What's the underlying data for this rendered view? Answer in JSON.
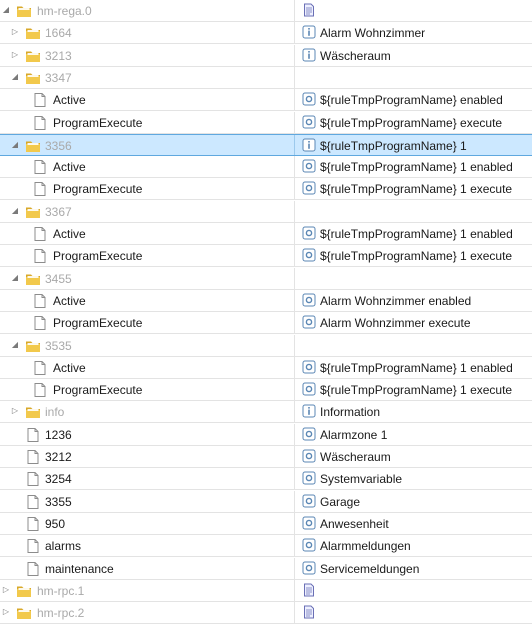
{
  "rows": [
    {
      "name": "hm-rega.0",
      "kind": "folder",
      "depth": 0,
      "expanded": true,
      "dim": true,
      "value": "",
      "value_icon": "document-icon"
    },
    {
      "name": "1664",
      "kind": "folder",
      "depth": 1,
      "expanded": false,
      "dim": true,
      "value": "Alarm Wohnzimmer",
      "value_icon": "info-icon"
    },
    {
      "name": "3213",
      "kind": "folder",
      "depth": 1,
      "expanded": false,
      "dim": true,
      "value": "Wäscheraum",
      "value_icon": "info-icon"
    },
    {
      "name": "3347",
      "kind": "folder",
      "depth": 1,
      "expanded": true,
      "dim": true,
      "value": "",
      "value_icon": ""
    },
    {
      "name": "Active",
      "kind": "file",
      "depth": 2,
      "dim": false,
      "value": "${ruleTmpProgramName} enabled",
      "value_icon": "state-icon"
    },
    {
      "name": "ProgramExecute",
      "kind": "file",
      "depth": 2,
      "dim": false,
      "value": "${ruleTmpProgramName} execute",
      "value_icon": "state-icon"
    },
    {
      "name": "3356",
      "kind": "folder",
      "depth": 1,
      "expanded": true,
      "dim": true,
      "selected": true,
      "value": "${ruleTmpProgramName} 1",
      "value_icon": "info-icon"
    },
    {
      "name": "Active",
      "kind": "file",
      "depth": 2,
      "dim": false,
      "value": "${ruleTmpProgramName} 1 enabled",
      "value_icon": "state-icon"
    },
    {
      "name": "ProgramExecute",
      "kind": "file",
      "depth": 2,
      "dim": false,
      "value": "${ruleTmpProgramName} 1 execute",
      "value_icon": "state-icon"
    },
    {
      "name": "3367",
      "kind": "folder",
      "depth": 1,
      "expanded": true,
      "dim": true,
      "value": "",
      "value_icon": ""
    },
    {
      "name": "Active",
      "kind": "file",
      "depth": 2,
      "dim": false,
      "value": "${ruleTmpProgramName} 1 enabled",
      "value_icon": "state-icon"
    },
    {
      "name": "ProgramExecute",
      "kind": "file",
      "depth": 2,
      "dim": false,
      "value": "${ruleTmpProgramName} 1 execute",
      "value_icon": "state-icon"
    },
    {
      "name": "3455",
      "kind": "folder",
      "depth": 1,
      "expanded": true,
      "dim": true,
      "value": "",
      "value_icon": ""
    },
    {
      "name": "Active",
      "kind": "file",
      "depth": 2,
      "dim": false,
      "value": "Alarm Wohnzimmer enabled",
      "value_icon": "state-icon"
    },
    {
      "name": "ProgramExecute",
      "kind": "file",
      "depth": 2,
      "dim": false,
      "value": "Alarm Wohnzimmer execute",
      "value_icon": "state-icon"
    },
    {
      "name": "3535",
      "kind": "folder",
      "depth": 1,
      "expanded": true,
      "dim": true,
      "value": "",
      "value_icon": ""
    },
    {
      "name": "Active",
      "kind": "file",
      "depth": 2,
      "dim": false,
      "value": "${ruleTmpProgramName} 1 enabled",
      "value_icon": "state-icon"
    },
    {
      "name": "ProgramExecute",
      "kind": "file",
      "depth": 2,
      "dim": false,
      "value": "${ruleTmpProgramName} 1 execute",
      "value_icon": "state-icon"
    },
    {
      "name": "info",
      "kind": "folder",
      "depth": 1,
      "expanded": false,
      "dim": true,
      "value": "Information",
      "value_icon": "info-icon"
    },
    {
      "name": "1236",
      "kind": "file",
      "depth": 1,
      "dim": false,
      "value": "Alarmzone 1",
      "value_icon": "state-icon"
    },
    {
      "name": "3212",
      "kind": "file",
      "depth": 1,
      "dim": false,
      "value": "Wäscheraum",
      "value_icon": "state-icon"
    },
    {
      "name": "3254",
      "kind": "file",
      "depth": 1,
      "dim": false,
      "value": "Systemvariable",
      "value_icon": "state-icon"
    },
    {
      "name": "3355",
      "kind": "file",
      "depth": 1,
      "dim": false,
      "value": "Garage",
      "value_icon": "state-icon"
    },
    {
      "name": "950",
      "kind": "file",
      "depth": 1,
      "dim": false,
      "value": "Anwesenheit",
      "value_icon": "state-icon"
    },
    {
      "name": "alarms",
      "kind": "file",
      "depth": 1,
      "dim": false,
      "value": "Alarmmeldungen",
      "value_icon": "state-icon"
    },
    {
      "name": "maintenance",
      "kind": "file",
      "depth": 1,
      "dim": false,
      "value": "Servicemeldungen",
      "value_icon": "state-icon"
    },
    {
      "name": "hm-rpc.1",
      "kind": "folder",
      "depth": 0,
      "expanded": false,
      "dim": true,
      "value": "",
      "value_icon": "document-icon"
    },
    {
      "name": "hm-rpc.2",
      "kind": "folder",
      "depth": 0,
      "expanded": false,
      "dim": true,
      "value": "",
      "value_icon": "document-icon"
    }
  ],
  "colors": {
    "folder": "#f2c94c",
    "folder_dark": "#d9a92a",
    "selection": "#cce8ff",
    "dim_text": "#a9a9a9",
    "icon_blue": "#5b87b4"
  }
}
